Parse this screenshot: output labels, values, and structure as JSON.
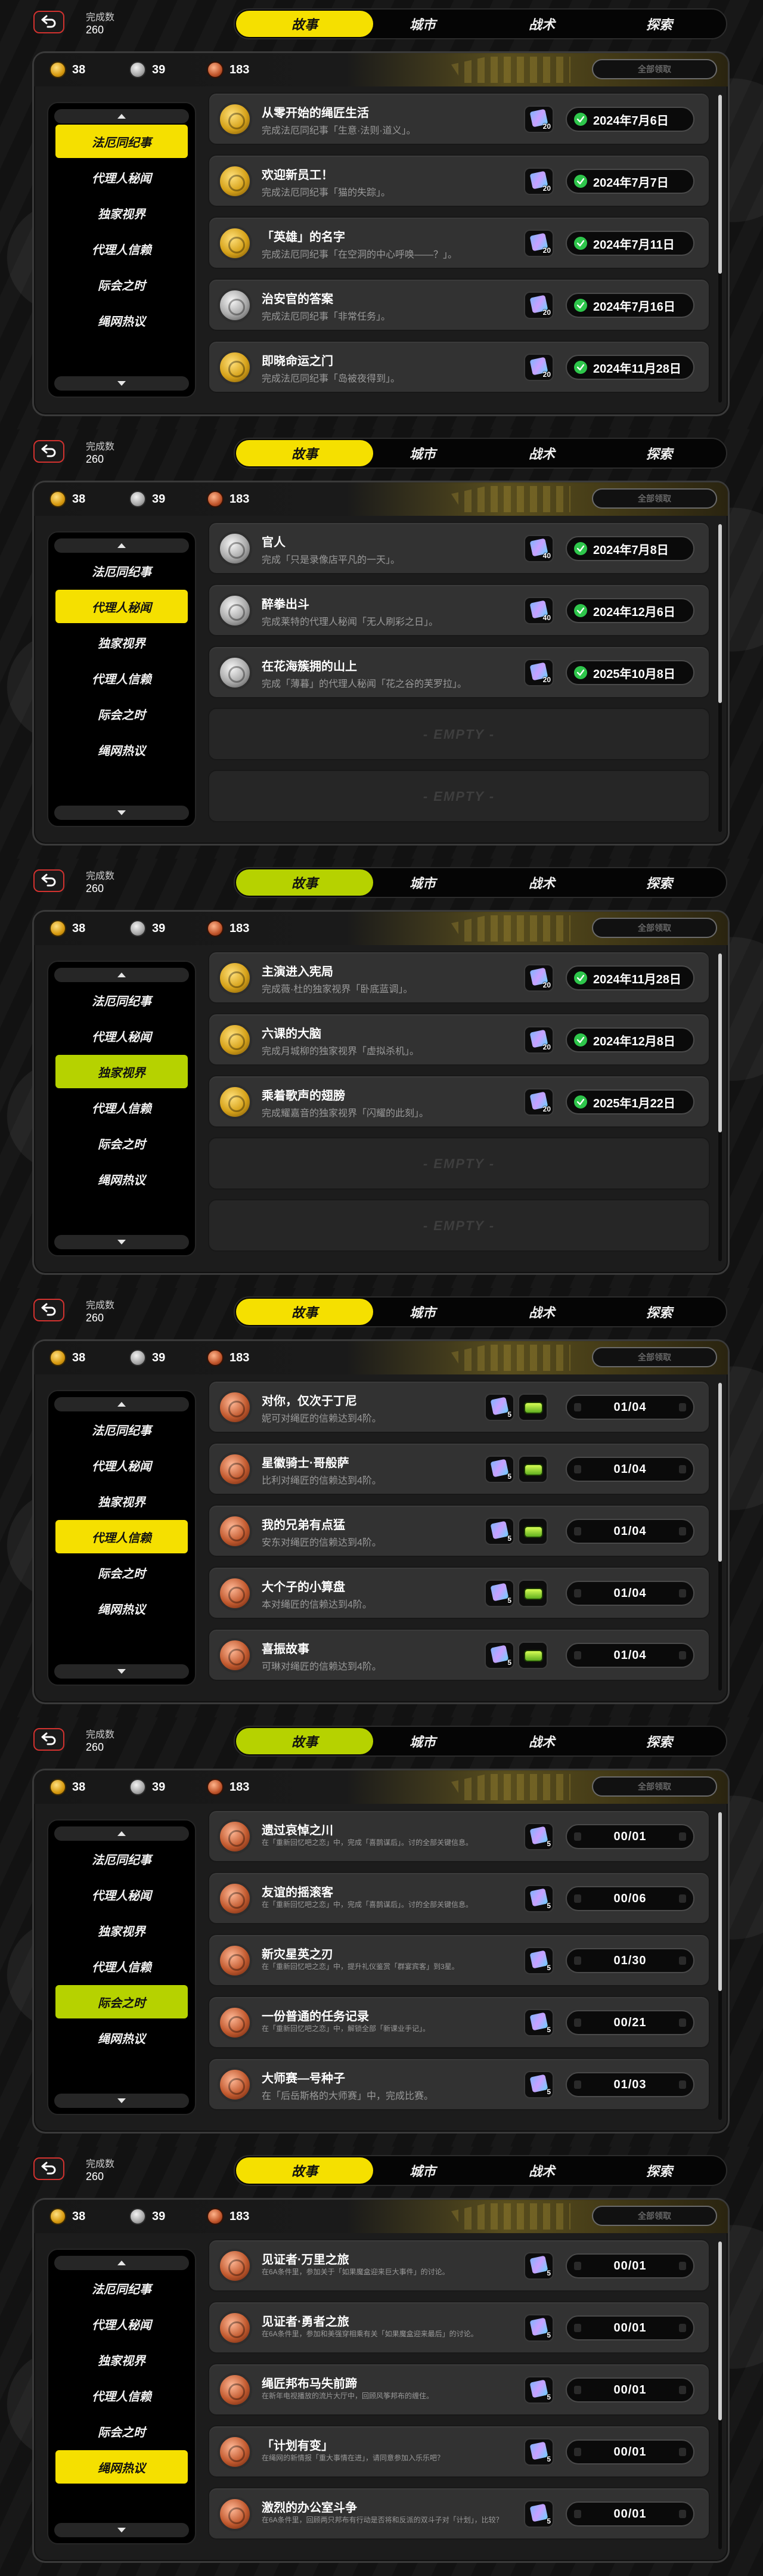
{
  "common": {
    "completion_label": "完成数",
    "completion_value": "260",
    "tabs": [
      "故事",
      "城市",
      "战术",
      "探索"
    ],
    "currencies": [
      {
        "kind": "gold",
        "value": "38"
      },
      {
        "kind": "silver",
        "value": "39"
      },
      {
        "kind": "bronze",
        "value": "183"
      }
    ],
    "claim_all_label": "全部领取",
    "sidebar": [
      "法厄同纪事",
      "代理人秘闻",
      "独家视界",
      "代理人信赖",
      "际会之时",
      "绳网热议"
    ],
    "empty_label": "- EMPTY -",
    "colors": {
      "accent_yellow": "#f5e000",
      "accent_lime": "#b6d200",
      "complete_green": "#2ec64b",
      "back_red": "#d2322f"
    },
    "icons": {
      "back": "back-arrow-icon",
      "check": "check-circle-icon",
      "reward": "film-ticket-icon",
      "token": "token-icon"
    }
  },
  "screens": [
    {
      "active_sidebar": 0,
      "accent": "yellow",
      "rows": [
        {
          "medal": "gold",
          "title": "从零开始的绳匠生活",
          "desc": "完成法厄同纪事「生意·法则·道义」。",
          "reward": [
            "20"
          ],
          "status": "2024年7月6日",
          "done": true
        },
        {
          "medal": "gold",
          "title": "欢迎新员工！",
          "desc": "完成法厄同纪事「猫的失踪」。",
          "reward": [
            "20"
          ],
          "status": "2024年7月7日",
          "done": true
        },
        {
          "medal": "gold",
          "title": "「英雄」的名字",
          "desc": "完成法厄同纪事「在空洞的中心呼唤——？」。",
          "reward": [
            "20"
          ],
          "status": "2024年7月11日",
          "done": true
        },
        {
          "medal": "silver",
          "title": "治安官的答案",
          "desc": "完成法厄同纪事「非常任务」。",
          "reward": [
            "20"
          ],
          "status": "2024年7月16日",
          "done": true
        },
        {
          "medal": "gold",
          "title": "即晓命运之门",
          "desc": "完成法厄同纪事「岛被夜得到」。",
          "reward": [
            "20"
          ],
          "status": "2024年11月28日",
          "done": true
        }
      ]
    },
    {
      "active_sidebar": 1,
      "accent": "yellow",
      "rows": [
        {
          "medal": "silver",
          "title": "官人",
          "desc": "完成「只是录像店平凡的一天」。",
          "reward": [
            "40"
          ],
          "status": "2024年7月8日",
          "done": true
        },
        {
          "medal": "silver",
          "title": "醉拳出斗",
          "desc": "完成莱特的代理人秘闻「无人刷彩之日」。",
          "reward": [
            "40"
          ],
          "status": "2024年12月6日",
          "done": true
        },
        {
          "medal": "silver",
          "title": "在花海簇拥的山上",
          "desc": "完成「薄暮」的代理人秘闻「花之谷的芙罗拉」。",
          "reward": [
            "20"
          ],
          "status": "2025年10月8日",
          "done": true
        },
        {
          "empty": true
        },
        {
          "empty": true
        }
      ]
    },
    {
      "active_sidebar": 2,
      "accent": "lime",
      "rows": [
        {
          "medal": "gold",
          "title": "主演进入宪局",
          "desc": "完成薇·杜的独家视界「卧底蓝调」。",
          "reward": [
            "20"
          ],
          "status": "2024年11月28日",
          "done": true
        },
        {
          "medal": "gold",
          "title": "六课的大脑",
          "desc": "完成月城柳的独家视界「虚拟杀机」。",
          "reward": [
            "20"
          ],
          "status": "2024年12月8日",
          "done": true
        },
        {
          "medal": "gold",
          "title": "乘着歌声的翅膀",
          "desc": "完成耀嘉音的独家视界「闪耀的此刻」。",
          "reward": [
            "20"
          ],
          "status": "2025年1月22日",
          "done": true
        },
        {
          "empty": true
        },
        {
          "empty": true
        }
      ]
    },
    {
      "active_sidebar": 3,
      "accent": "yellow",
      "rows": [
        {
          "medal": "bronze",
          "title": "对你，仅次于丁尼",
          "desc": "妮可对绳匠的信赖达到4阶。",
          "reward": [
            "5",
            "token"
          ],
          "status": "01/04",
          "done": false
        },
        {
          "medal": "bronze",
          "title": "星徽骑士·哥般萨",
          "desc": "比利对绳匠的信赖达到4阶。",
          "reward": [
            "5",
            "token"
          ],
          "status": "01/04",
          "done": false
        },
        {
          "medal": "bronze",
          "title": "我的兄弟有点猛",
          "desc": "安东对绳匠的信赖达到4阶。",
          "reward": [
            "5",
            "token"
          ],
          "status": "01/04",
          "done": false
        },
        {
          "medal": "bronze",
          "title": "大个子的小算盘",
          "desc": "本对绳匠的信赖达到4阶。",
          "reward": [
            "5",
            "token"
          ],
          "status": "01/04",
          "done": false
        },
        {
          "medal": "bronze",
          "title": "喜振故事",
          "desc": "可琳对绳匠的信赖达到4阶。",
          "reward": [
            "5",
            "token"
          ],
          "status": "01/04",
          "done": false
        }
      ]
    },
    {
      "active_sidebar": 4,
      "accent": "lime",
      "rows": [
        {
          "medal": "bronze",
          "title": "遗过哀悼之川",
          "desc": "在「重新回忆吧之恋」中，完成「喜鹊谋后」。讨的全部关键信息。",
          "small": true,
          "reward": [
            "5"
          ],
          "status": "00/01",
          "done": false
        },
        {
          "medal": "bronze",
          "title": "友谊的摇滚客",
          "desc": "在「重新回忆吧之恋」中，完成「喜鹊谋后」。讨的全部关键信息。",
          "small": true,
          "reward": [
            "5"
          ],
          "status": "00/06",
          "done": false
        },
        {
          "medal": "bronze",
          "title": "新灾星英之刃",
          "desc": "在「重新回忆吧之恋」中，提升礼仪鉴赏「群宴宾客」到3星。",
          "small": true,
          "reward": [
            "5"
          ],
          "status": "01/30",
          "done": false
        },
        {
          "medal": "bronze",
          "title": "一份普通的任务记录",
          "desc": "在「重新回忆吧之恋」中，解锁全部「新课业手记」。",
          "small": true,
          "reward": [
            "5"
          ],
          "status": "00/21",
          "done": false
        },
        {
          "medal": "bronze",
          "title": "大师赛—号种子",
          "desc": "在「后岳斯格的大师赛」中，完成比赛。",
          "reward": [
            "5"
          ],
          "status": "01/03",
          "done": false
        }
      ]
    },
    {
      "active_sidebar": 5,
      "accent": "yellow",
      "rows": [
        {
          "medal": "bronze",
          "title": "见证者·万里之旅",
          "desc": "在6A条件里，参加关于「如果魔盒迎来巨大事件」的讨论。",
          "small": true,
          "reward": [
            "5"
          ],
          "status": "00/01",
          "done": false
        },
        {
          "medal": "bronze",
          "title": "见证者·勇者之旅",
          "desc": "在6A条件里，参加和美强穿相乘有关「如果魔盒迎来最后」的讨论。",
          "small": true,
          "reward": [
            "5"
          ],
          "status": "00/01",
          "done": false
        },
        {
          "medal": "bronze",
          "title": "绳匠邦布马失前蹄",
          "desc": "在新年电视播放的流片大厅中，回顾风筝邦布的缠住。",
          "small": true,
          "reward": [
            "5"
          ],
          "status": "00/01",
          "done": false
        },
        {
          "medal": "bronze",
          "title": "「计划有变」",
          "desc": "在绳网的新情报「重大事情在进」，请同意参加入乐乐吧？",
          "small": true,
          "reward": [
            "5"
          ],
          "status": "00/01",
          "done": false
        },
        {
          "medal": "bronze",
          "title": "激烈的办公室斗争",
          "desc": "在6A条件里，回顾两只邦布有行动是否将和反派的双斗子对「计划」，比较？",
          "small": true,
          "reward": [
            "5"
          ],
          "status": "00/01",
          "done": false
        }
      ]
    }
  ]
}
